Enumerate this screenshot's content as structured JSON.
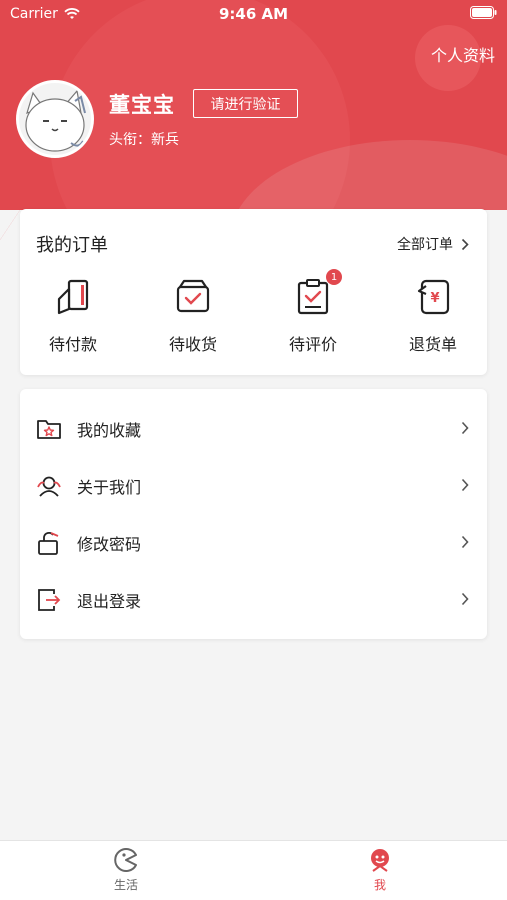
{
  "status_bar": {
    "carrier": "Carrier",
    "time": "9:46 AM"
  },
  "header": {
    "profile_link": "个人资料",
    "username": "董宝宝",
    "verify_button": "请进行验证",
    "rank": "头衔：新兵"
  },
  "orders": {
    "title": "我的订单",
    "all_orders": "全部订单",
    "items": [
      {
        "label": "待付款",
        "icon": "wallet-card-icon"
      },
      {
        "label": "待收货",
        "icon": "box-check-icon"
      },
      {
        "label": "待评价",
        "icon": "clipboard-check-icon",
        "badge": "1"
      },
      {
        "label": "退货单",
        "icon": "refund-yuan-icon"
      }
    ]
  },
  "menu": {
    "items": [
      {
        "label": "我的收藏",
        "icon": "folder-star-icon"
      },
      {
        "label": "关于我们",
        "icon": "users-icon"
      },
      {
        "label": "修改密码",
        "icon": "unlock-icon"
      },
      {
        "label": "退出登录",
        "icon": "logout-icon"
      }
    ]
  },
  "tabbar": {
    "items": [
      {
        "label": "生活",
        "icon": "pacman-icon",
        "active": false
      },
      {
        "label": "我",
        "icon": "face-icon",
        "active": true
      }
    ]
  },
  "colors": {
    "accent": "#e1484e",
    "text": "#222222",
    "background": "#f4f4f4"
  }
}
